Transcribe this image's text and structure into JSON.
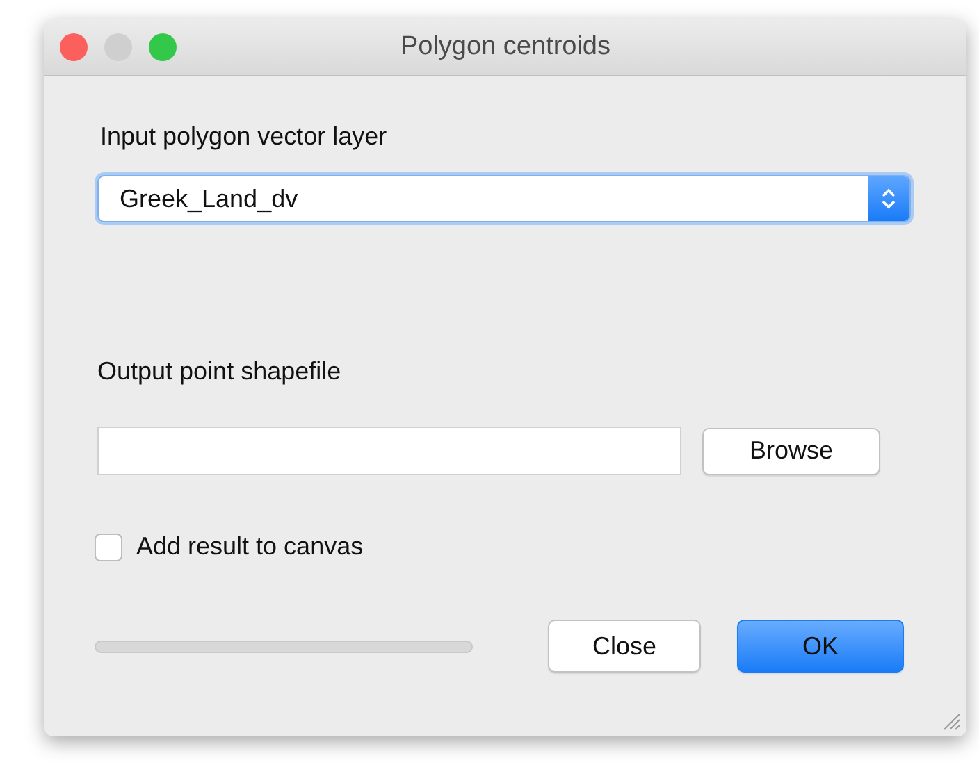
{
  "window": {
    "title": "Polygon centroids",
    "controls": [
      {
        "kind": "close",
        "disabled": false
      },
      {
        "kind": "minimize",
        "disabled": true
      },
      {
        "kind": "zoom",
        "disabled": false
      }
    ]
  },
  "input_layer": {
    "label": "Input polygon vector layer",
    "value": "Greek_Land_dv"
  },
  "output": {
    "label": "Output point shapefile",
    "browse": "Browse"
  },
  "add_to_canvas": {
    "label": "Add result to canvas",
    "checked": false
  },
  "progress": {
    "level": 0
  },
  "buttons": [
    {
      "label": "Close",
      "default": false
    },
    {
      "label": "OK",
      "default": true
    }
  ]
}
